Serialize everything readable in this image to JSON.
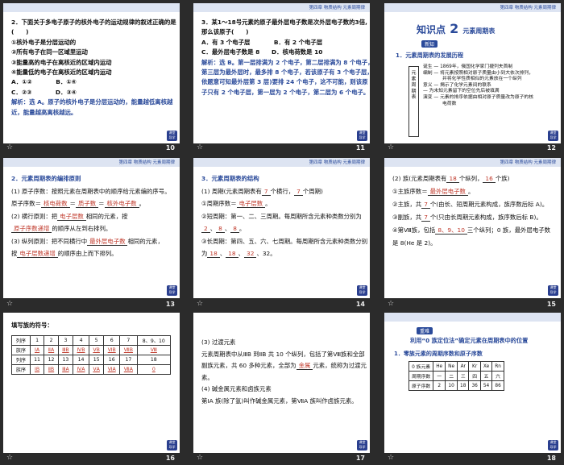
{
  "header": "第四章 物质结构 元素周期律",
  "corner": [
    "课堂",
    "导学"
  ],
  "slides": {
    "s10": {
      "number": "10",
      "lines": [
        "2．下面关于多电子原子的核外电子的运动规律的叙述正确的是",
        "(　　)",
        "①核外电子是分层运动的",
        "②所有电子在同一区域里运动",
        "③能量高的电子在离核近的区域内运动",
        "④能量低的电子在离核近的区域内运动",
        "A．①②　　　　B．①④",
        "C．②③　　　　D．③④"
      ],
      "explain": [
        "解析：选 A。原子的核外电子是分层运动的，能量越低离核越",
        "近，能量越高离核越远。"
      ]
    },
    "s11": {
      "number": "11",
      "lines": [
        "3．某1～18号元素的原子最外层电子数是次外层电子数的3倍,",
        "那么该原子(　　)",
        "A．有 3 个电子层　　　　B．有 2 个电子层",
        "C．最外层电子数是 8　　D．核电荷数是 10"
      ],
      "explain": [
        "解析：选 B。第一层排满为 2 个电子，第二层排满为 8 个电子，",
        "第三层为最外层时，最多排 8 个电子，若该原子有 3 个电子层，",
        "依题意可知最外层第 3 层)要排 24 个电子，这不可能，则该原",
        "子只有 2 个电子层，第一层为 2 个电子，第二层为 6 个电子。"
      ]
    },
    "s12": {
      "number": "12",
      "kp_label": "知识点",
      "kp_num": "2",
      "kp_title": "元素周期表",
      "sub": "新知",
      "section": "1．元素周期表的发展历程",
      "boxtext": "元素周期表",
      "items": [
        "诞生 — 1869年，俄国化学家门捷列夫首制",
        "编制 — 将元素按照相对原子质量由小到大依次排列，",
        "并将化学性质相似的元素放在一个纵列",
        "意义 — 揭示了化学元素间的联系",
        "— 为未知元素留下的空位先后被填满",
        "演变 — 元素的排序依据由相对原子质量改为原子的核",
        "电荷数"
      ]
    },
    "s13": {
      "number": "13",
      "section": "2．元素周期表的编排原则",
      "l1": "(1) 原子序数：按照元素在周期表中的顺序给元素编的序号。",
      "l2a": "原子序数＝",
      "b1": "核电荷数",
      "l2b": "＝",
      "b2": "质子数",
      "l2c": "＝",
      "b3": "核外电子数",
      "l2d": "。",
      "l3a": "(2) 横行原则：把",
      "b4": "电子层数",
      "l3b": "相同的元素，按",
      "b5": "原子序数递增",
      "l4": "的顺序从左到右排列。",
      "l5a": "(3) 纵列原则：把不同横行中",
      "b6": "最外层电子数",
      "l5b": "相同的元素，",
      "l6a": "按",
      "b7": "电子层数递增",
      "l6b": "的顺序由上而下排列。"
    },
    "s14": {
      "number": "14",
      "section": "3．元素周期表的结构",
      "l1a": "(1) 周期(元素周期表有",
      "b1": "7",
      "l1b": "个横行，",
      "b2": "7",
      "l1c": "个周期)",
      "l2a": "①周期序数＝",
      "b3": "电子层数",
      "l2b": "。",
      "l3": "②短周期：第一、二、三周期。每周期所含元素种类数分别为",
      "b4": "2",
      "b5": "8",
      "b6": "8",
      "l5": "③长周期：第四、五、六、七周期。每周期所含元素种类数分别",
      "l6a": "为",
      "b7": "18",
      "b8": "18",
      "b9": "32",
      "l6b": "、32。"
    },
    "s15": {
      "number": "15",
      "l1a": "(2) 族(元素周期表有",
      "b1": "18",
      "l1b": "个纵列，",
      "b2": "16",
      "l1c": "个族)",
      "l2a": "①主族序数＝",
      "b3": "最外层电子数",
      "l2b": "。",
      "l3a": "②主族，共",
      "b4": "7",
      "l3b": "个(由长、短周期元素构成，族序数后标 A)。",
      "l4a": "③副族，共",
      "b5": "7",
      "l4b": "个(只由长周期元素构成，族序数后标 B)。",
      "l5a": "④第Ⅷ族，包括",
      "b6": "8、9、10",
      "l5b": "三个纵列；0 族，最外层电子数",
      "l6": "是 8(He 是 2)。"
    },
    "s16": {
      "number": "16",
      "title": "填写族的符号：",
      "rows": [
        [
          "列序",
          "1",
          "2",
          "3",
          "4",
          "5",
          "6",
          "7",
          "8、9、10"
        ],
        [
          "族序",
          "ⅠA",
          "ⅡA",
          "ⅢB",
          "ⅣB",
          "ⅤB",
          "ⅥB",
          "ⅦB",
          "Ⅷ"
        ],
        [
          "列序",
          "11",
          "12",
          "13",
          "14",
          "15",
          "16",
          "17",
          "18"
        ],
        [
          "族序",
          "ⅠB",
          "ⅡB",
          "ⅢA",
          "ⅣA",
          "ⅤA",
          "ⅥA",
          "ⅦA",
          "0"
        ]
      ]
    },
    "s17": {
      "number": "17",
      "l1": "(3) 过渡元素",
      "l2": "元素周期表中从ⅢB 到ⅡB 共 10 个纵列，包括了第Ⅷ族和全部",
      "l3a": "副族元素，共 60 多种元素，全部为",
      "b1": "金属",
      "l3b": "元素，统称为过渡元",
      "l4": "素。",
      "l5": "(4) 碱金属元素和卤族元素",
      "l6": "第ⅠA 族(除了氢)叫作碱金属元素，第ⅦA 族叫作卤族元素。"
    },
    "s18": {
      "number": "18",
      "badge": "重难",
      "title": "利用“0 族定位法”确定元素在周期表中的位置",
      "section": "1．零族元素的周期序数和原子序数",
      "rows": [
        [
          "0 族元素",
          "He",
          "Ne",
          "Ar",
          "Kr",
          "Xe",
          "Rn"
        ],
        [
          "周期序数",
          "一",
          "二",
          "三",
          "四",
          "五",
          "六"
        ],
        [
          "原子序数",
          "2",
          "10",
          "18",
          "36",
          "54",
          "86"
        ]
      ]
    }
  }
}
